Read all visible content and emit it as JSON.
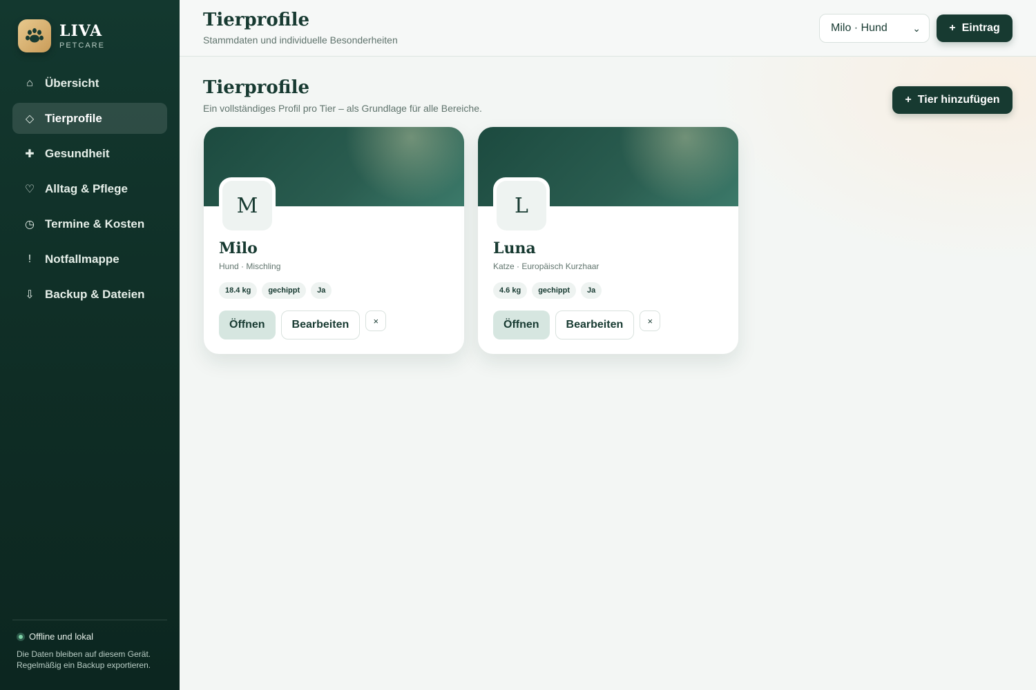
{
  "brand": {
    "name": "LIVA",
    "subtitle": "PETCARE",
    "logo_icon": "paw-icon"
  },
  "nav": {
    "items": [
      {
        "label": "Übersicht",
        "icon": "home-icon",
        "active": false
      },
      {
        "label": "Tierprofile",
        "icon": "diamond-icon",
        "active": true
      },
      {
        "label": "Gesundheit",
        "icon": "cross-icon",
        "active": false
      },
      {
        "label": "Alltag & Pflege",
        "icon": "heart-icon",
        "active": false
      },
      {
        "label": "Termine & Kosten",
        "icon": "clock-icon",
        "active": false
      },
      {
        "label": "Notfallmappe",
        "icon": "exclamation-icon",
        "active": false
      },
      {
        "label": "Backup & Dateien",
        "icon": "download-icon",
        "active": false
      }
    ]
  },
  "sidebar_footer": {
    "status": "Offline und lokal",
    "note": "Die Daten bleiben auf diesem Gerät. Regelmäßig ein Backup exportieren."
  },
  "header": {
    "title": "Tierprofile",
    "subtitle": "Stammdaten und individuelle Besonderheiten",
    "pet_select": {
      "value": "Milo · Hund"
    },
    "entry_button": "Eintrag"
  },
  "main": {
    "title": "Tierprofile",
    "subtitle": "Ein vollständiges Profil pro Tier – als Grundlage für alle Bereiche.",
    "add_button": "Tier hinzufügen"
  },
  "pets": [
    {
      "initial": "M",
      "name": "Milo",
      "breed": "Hund · Mischling",
      "chips": [
        "18.4 kg",
        "gechippt",
        "Ja"
      ],
      "open_label": "Öffnen",
      "edit_label": "Bearbeiten",
      "delete_label": "×"
    },
    {
      "initial": "L",
      "name": "Luna",
      "breed": "Katze · Europäisch Kurzhaar",
      "chips": [
        "4.6 kg",
        "gechippt",
        "Ja"
      ],
      "open_label": "Öffnen",
      "edit_label": "Bearbeiten",
      "delete_label": "×"
    }
  ],
  "colors": {
    "primary": "#173a31",
    "sidebar": "#13382f",
    "accent_gold": "#d9b57a",
    "soft": "#d6e6e0"
  }
}
